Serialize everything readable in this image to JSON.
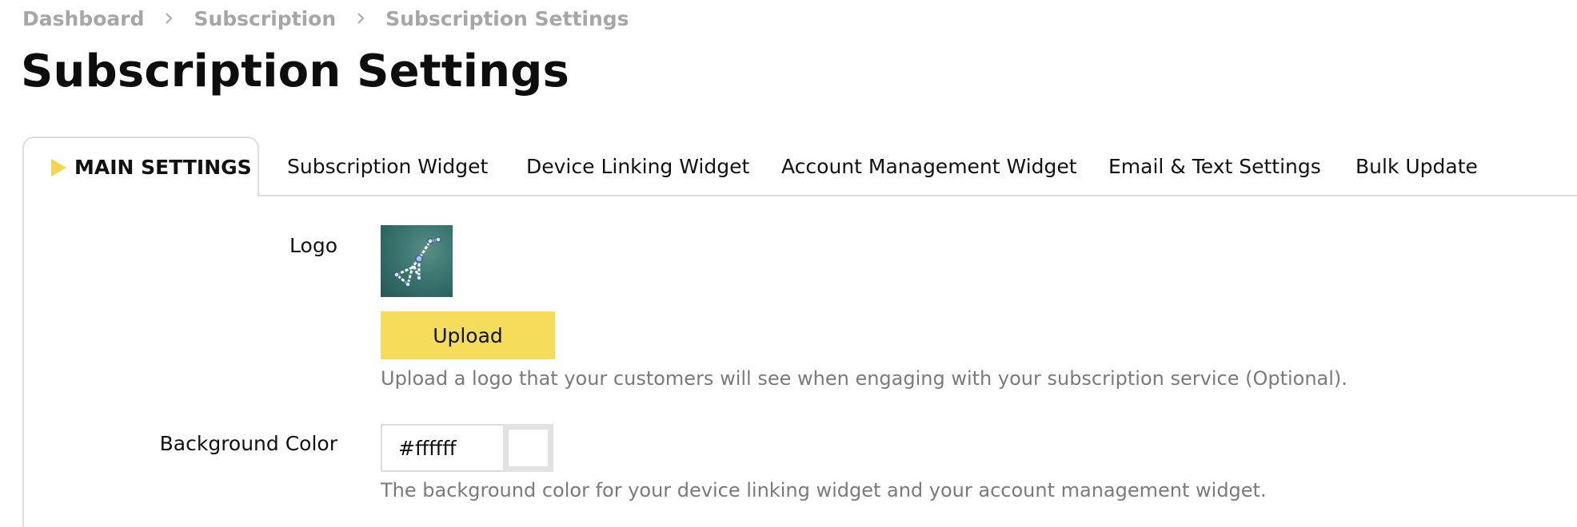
{
  "breadcrumb": {
    "items": [
      "Dashboard",
      "Subscription",
      "Subscription Settings"
    ]
  },
  "page_title": "Subscription Settings",
  "tabs": [
    {
      "label": "MAIN SETTINGS",
      "active": true
    },
    {
      "label": "Subscription Widget",
      "active": false
    },
    {
      "label": "Device Linking Widget",
      "active": false
    },
    {
      "label": "Account Management Widget",
      "active": false
    },
    {
      "label": "Email & Text Settings",
      "active": false
    },
    {
      "label": "Bulk Update",
      "active": false
    }
  ],
  "logo": {
    "label": "Logo",
    "upload_label": "Upload",
    "help": "Upload a logo that your customers will see when engaging with your subscription service (Optional)."
  },
  "background_color": {
    "label": "Background Color",
    "value": "#ffffff",
    "help": "The background color for your device linking widget and your account management widget."
  },
  "colors": {
    "accent": "#f5dc5a",
    "tab_marker": "#f3d64b",
    "muted_text": "#7a7a7a",
    "breadcrumb_text": "#a6a6a6",
    "border": "#dcdcdc"
  },
  "icons": {
    "tab_marker": "triangle-right-icon",
    "breadcrumb_separator": "chevron-right-icon"
  }
}
